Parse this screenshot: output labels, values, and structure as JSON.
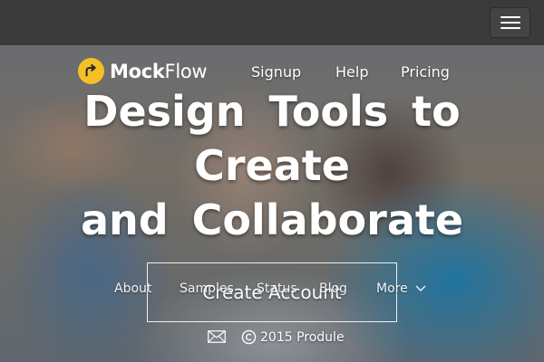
{
  "brand": {
    "name_strong": "Mock",
    "name_light": "Flow"
  },
  "nav": {
    "signup": "Signup",
    "help": "Help",
    "pricing": "Pricing"
  },
  "headline": {
    "line1": "Design Tools to",
    "line2": "Create",
    "line3": "and Collaborate"
  },
  "cta": {
    "label": "Create Account"
  },
  "footer_nav": {
    "about": "About",
    "samples": "Samples",
    "status": "Status",
    "blog": "Blog",
    "more": "More"
  },
  "footer": {
    "copyright": "2015 Produle"
  },
  "colors": {
    "logo": "#f4c025",
    "topbar": "#3a3a3a",
    "text": "#ffffff"
  },
  "icons": [
    "menu-icon",
    "mockflow-logo-icon",
    "chevron-down-icon",
    "mail-icon",
    "copyright-icon"
  ]
}
